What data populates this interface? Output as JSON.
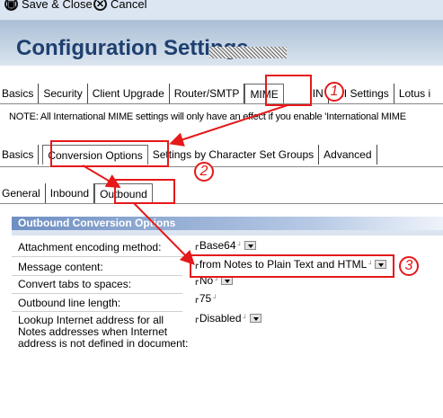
{
  "toolbar": {
    "save_close": "Save & Close",
    "cancel": "Cancel"
  },
  "header": {
    "title": "Configuration Settings"
  },
  "main_tabs": [
    "Basics",
    "Security",
    "Client Upgrade",
    "Router/SMTP",
    "MIME",
    "IN",
    "INI Settings",
    "Lotus i"
  ],
  "note": "NOTE: All International MIME settings will only have an effect if you enable 'International MIME",
  "mime_tabs": [
    "Basics",
    "Conversion Options",
    "Settings by Character Set Groups",
    "Advanced"
  ],
  "conv_tabs": [
    "General",
    "Inbound",
    "Outbound"
  ],
  "section": {
    "title": "Outbound Conversion Options"
  },
  "fields": [
    {
      "label": "Attachment encoding method:",
      "value": "Base64"
    },
    {
      "label": "Message content:",
      "value": "from Notes to Plain Text and HTML"
    },
    {
      "label": "Convert tabs to spaces:",
      "value": "No"
    },
    {
      "label": "Outbound line length:",
      "value": "75"
    },
    {
      "label": "Lookup Internet address for all Notes addresses when Internet address is not defined in document:",
      "value": "Disabled"
    }
  ],
  "callouts": [
    "1",
    "2",
    "3"
  ],
  "colors": {
    "annotation": "#e5191a",
    "title": "#1f3f6e",
    "section_header": "#6e8fc2"
  },
  "icons": {
    "save": "save-icon",
    "cancel": "cancel-x-icon",
    "dropdown": "dropdown-arrow-icon"
  }
}
